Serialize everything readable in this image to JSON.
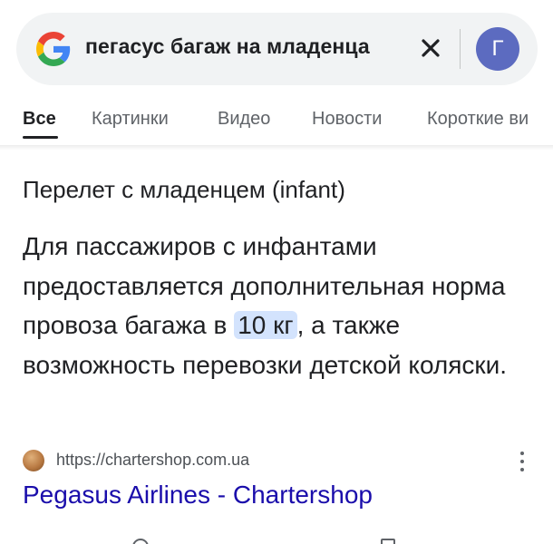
{
  "search": {
    "query": "пегасус багаж на младенца",
    "clear_icon": "close-icon",
    "avatar_letter": "Г",
    "avatar_color": "#5c6bc0"
  },
  "tabs": [
    {
      "label": "Все",
      "active": true
    },
    {
      "label": "Картинки",
      "active": false
    },
    {
      "label": "Видео",
      "active": false
    },
    {
      "label": "Новости",
      "active": false
    },
    {
      "label": "Короткие ви",
      "active": false
    }
  ],
  "snippet": {
    "title": "Перелет с младенцем (infant)",
    "text_before": "Для пассажиров с инфантами предоставляется дополнительная норма провоза багажа в ",
    "highlight": "10 кг",
    "text_after": ", а также возможность перевозки детской коляски."
  },
  "result": {
    "url": "https://chartershop.com.ua",
    "title": "Pegasus Airlines - Chartershop",
    "more_icon": "more-vert-icon"
  },
  "colors": {
    "link": "#1a0dab",
    "highlight_bg": "#d3e3fd",
    "search_bg": "#f1f3f4"
  }
}
